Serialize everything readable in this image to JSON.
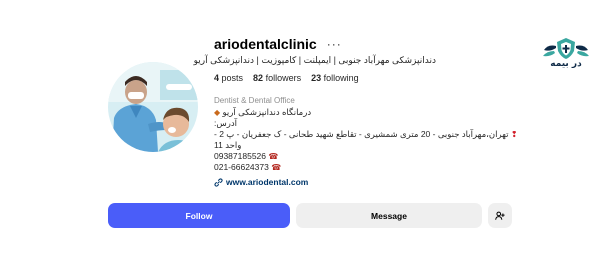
{
  "watermark": {
    "text": "در بیمه",
    "logo": "shield-leaf-logo",
    "colors": {
      "navy": "#0e2a47",
      "teal": "#3aa7a0"
    }
  },
  "profile": {
    "username": "ariodentalclinic",
    "more_icon": "ellipsis-icon",
    "title": "دندانپزشکی مهرآباد جنوبی | ایمپلنت | کامپوزیت | دندانپزشکی آریو",
    "stats": {
      "posts_count": "4",
      "posts_label": "posts",
      "followers_count": "82",
      "followers_label": "followers",
      "following_count": "23",
      "following_label": "following"
    },
    "category": "Dentist & Dental Office",
    "bio": {
      "line1": "درمانگاه دندانپزشکی آریو",
      "line2": "آدرس:",
      "line3": "تهران،مهرآباد جنوبی - 20 متری شمشیری - تقاطع شهید طحانی - ک جعفریان - پ 2 -",
      "line4": "واحد 11",
      "phone1": "09387185526",
      "phone2": "021-66624373"
    },
    "link": "www.ariodental.com",
    "link_icon": "link-icon"
  },
  "actions": {
    "follow_label": "Follow",
    "message_label": "Message",
    "suggest_icon": "add-person-icon"
  },
  "colors": {
    "follow_button": "#4a5df9",
    "secondary_button": "#efefef",
    "link": "#00376b",
    "muted_text": "#8e8e8e"
  }
}
